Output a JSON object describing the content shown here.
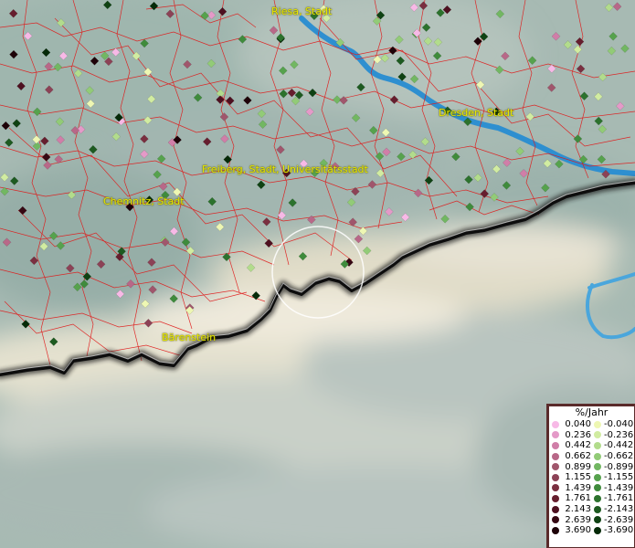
{
  "map": {
    "place_labels": [
      {
        "name": "Riesa, Stadt"
      },
      {
        "name": "Dresden, Stadt"
      },
      {
        "name": "Freiberg, Stadt, Universitätsstadt"
      },
      {
        "name": "Chemnitz, Stadt"
      },
      {
        "name": "Bärenstein"
      }
    ],
    "colors": {
      "terrain_base": "#a9bcb5",
      "border_lines": "#e01818",
      "river": "#2e8fd0",
      "state_border": "#111111",
      "label_text": "#e8e800",
      "highlight_circle": "#ffffff"
    }
  },
  "legend": {
    "title": "%/Jahr",
    "positive": [
      {
        "value": "0.040",
        "color": "#f7b9e6"
      },
      {
        "value": "0.236",
        "color": "#e49ac8"
      },
      {
        "value": "0.442",
        "color": "#d07ea8"
      },
      {
        "value": "0.662",
        "color": "#b86888"
      },
      {
        "value": "0.899",
        "color": "#a0566c"
      },
      {
        "value": "1.155",
        "color": "#8c4256"
      },
      {
        "value": "1.439",
        "color": "#7a2f40"
      },
      {
        "value": "1.761",
        "color": "#661e2e"
      },
      {
        "value": "2.143",
        "color": "#4e1020"
      },
      {
        "value": "2.639",
        "color": "#360813"
      },
      {
        "value": "3.690",
        "color": "#1e0208"
      }
    ],
    "negative": [
      {
        "value": "-0.040",
        "color": "#eef7b3"
      },
      {
        "value": "-0.236",
        "color": "#d1eca1"
      },
      {
        "value": "-0.442",
        "color": "#b2dc8c"
      },
      {
        "value": "-0.662",
        "color": "#92cb77"
      },
      {
        "value": "-0.899",
        "color": "#72b762"
      },
      {
        "value": "-1.155",
        "color": "#56a24d"
      },
      {
        "value": "-1.439",
        "color": "#3f8b3c"
      },
      {
        "value": "-1.761",
        "color": "#2c722d"
      },
      {
        "value": "-2.143",
        "color": "#1d5a20"
      },
      {
        "value": "-2.639",
        "color": "#0f4213"
      },
      {
        "value": "-3.690",
        "color": "#052a08"
      }
    ]
  }
}
